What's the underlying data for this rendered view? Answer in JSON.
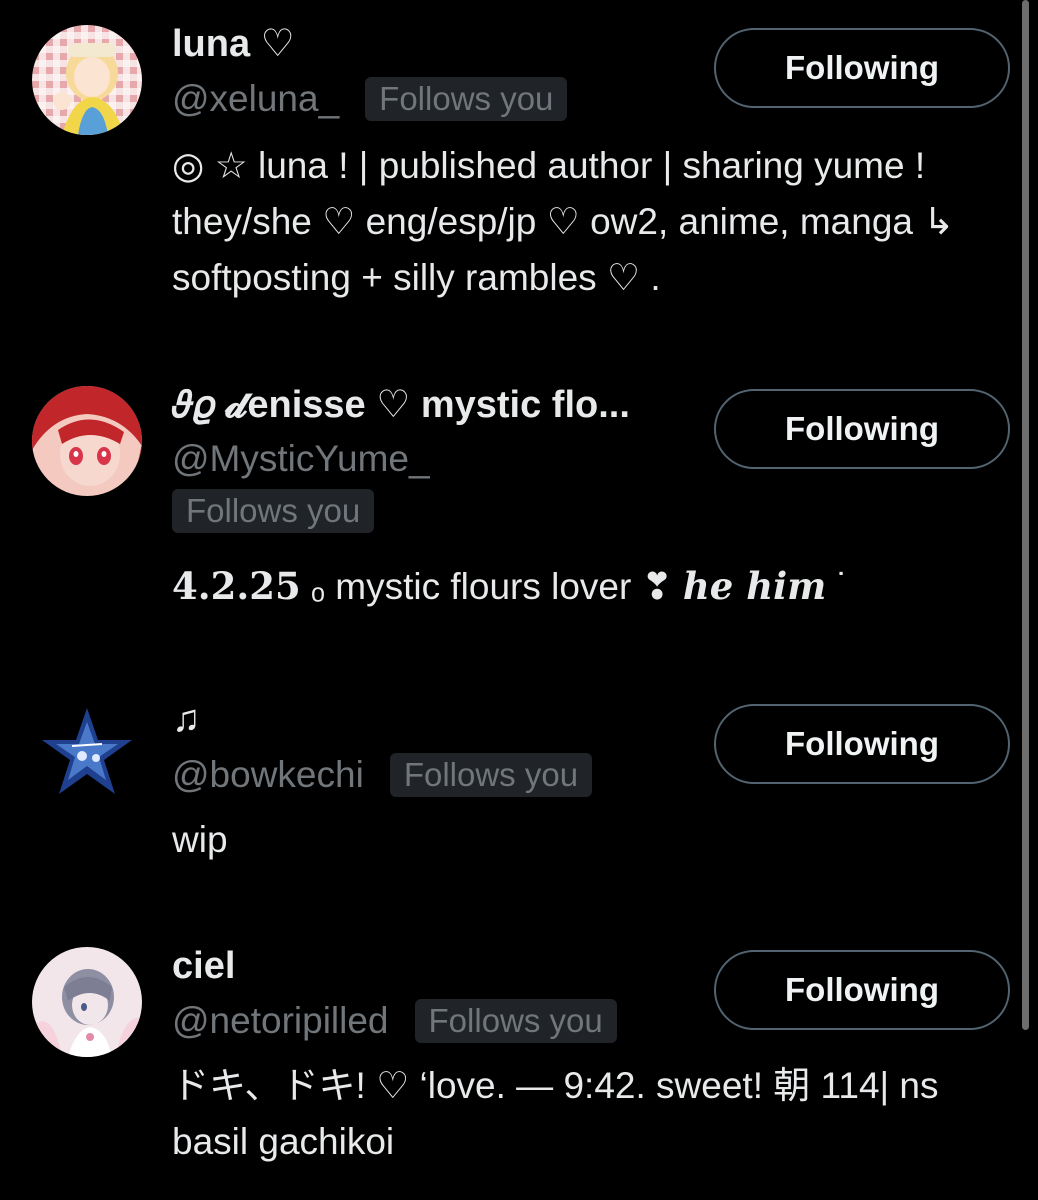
{
  "users": [
    {
      "name": "luna ♡",
      "handle": "@xeluna_",
      "follows_you": "Follows you",
      "bio": "◎ ☆ luna ! | published author | sharing yume ! they/she ♡ eng/esp/jp ♡ ow2, anime, manga ↳ softposting + silly rambles ♡ .",
      "button": "Following",
      "avatar_icon": "avatar-anime-girl-blonde"
    },
    {
      "name": "𝜗𝜚 𝓭enisse ♡ mystic flo...",
      "handle": "@MysticYume_",
      "follows_you": "Follows you",
      "bio_date": "4.2.25",
      "bio_mid": " ₒ mystic flours lover ❣ ",
      "bio_pronouns": "he him",
      "bio_end": " ˙",
      "button": "Following",
      "avatar_icon": "avatar-anime-red-hair"
    },
    {
      "name": "♫",
      "handle": "@bowkechi",
      "follows_you": "Follows you",
      "bio": "wip",
      "button": "Following",
      "avatar_icon": "avatar-star-blue"
    },
    {
      "name": "ciel",
      "handle": "@netoripilled",
      "follows_you": "Follows you",
      "bio": "ドキ、ドキ! ♡ ‘love. — 9:42. sweet! 朝 114| ns basil gachikoi",
      "button": "Following",
      "avatar_icon": "avatar-anime-grey-hair"
    }
  ],
  "colors": {
    "background": "#000000",
    "text": "#e7e9ea",
    "secondary": "#71767b",
    "badge_bg": "#202327",
    "button_border": "#536471"
  }
}
